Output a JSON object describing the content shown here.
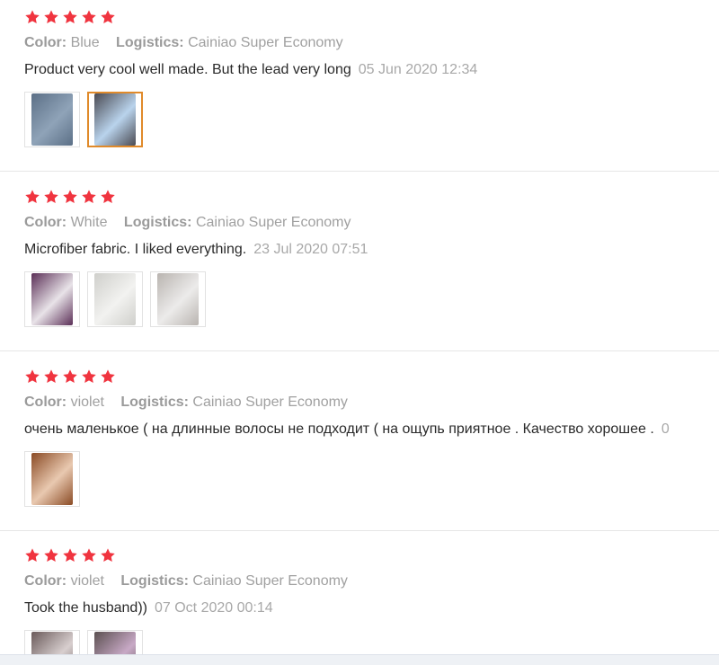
{
  "reviews": [
    {
      "rating": 5,
      "color_label": "Color:",
      "color_value": "Blue",
      "logistics_label": "Logistics:",
      "logistics_value": "Cainiao Super Economy",
      "text": "Product very cool well made. But the lead very long",
      "date": "05 Jun 2020 12:34",
      "photos": [
        {
          "name": "photo-blue-towel-1",
          "fill": "#5b6f86",
          "accent": "#8fa3b8"
        },
        {
          "name": "photo-blue-towel-2",
          "fill": "#4a4a52",
          "accent": "#b9d3ec",
          "selected": true
        }
      ]
    },
    {
      "rating": 5,
      "color_label": "Color:",
      "color_value": "White",
      "logistics_label": "Logistics:",
      "logistics_value": "Cainiao Super Economy",
      "text": "Microfiber fabric. I liked everything.",
      "date": "23 Jul 2020 07:51",
      "photos": [
        {
          "name": "photo-white-towel-1",
          "fill": "#5a2e56",
          "accent": "#e8e3e8"
        },
        {
          "name": "photo-white-towel-2",
          "fill": "#cfcfcb",
          "accent": "#f2f2f0"
        },
        {
          "name": "photo-white-towel-3",
          "fill": "#b9b4b0",
          "accent": "#ecebea"
        }
      ]
    },
    {
      "rating": 5,
      "color_label": "Color:",
      "color_value": "violet",
      "logistics_label": "Logistics:",
      "logistics_value": "Cainiao Super Economy",
      "text": "очень маленькое ( на длинные волосы не подходит ( на ощупь приятное . Качество хорошее .",
      "date": "0",
      "photos": [
        {
          "name": "photo-violet-towel-1",
          "fill": "#8a4a24",
          "accent": "#e9c9b0"
        }
      ]
    },
    {
      "rating": 5,
      "color_label": "Color:",
      "color_value": "violet",
      "logistics_label": "Logistics:",
      "logistics_value": "Cainiao Super Economy",
      "text": "Took the husband))",
      "date": "07 Oct 2020 00:14",
      "photos": [
        {
          "name": "photo-violet-towel-2",
          "fill": "#6a5a5a",
          "accent": "#d8cfcf"
        },
        {
          "name": "photo-violet-towel-3",
          "fill": "#5b5050",
          "accent": "#c8a9c6"
        }
      ]
    }
  ],
  "colors": {
    "star": "#f0343f",
    "divider": "#e6e6e6",
    "selected_border": "#e08a2a"
  }
}
